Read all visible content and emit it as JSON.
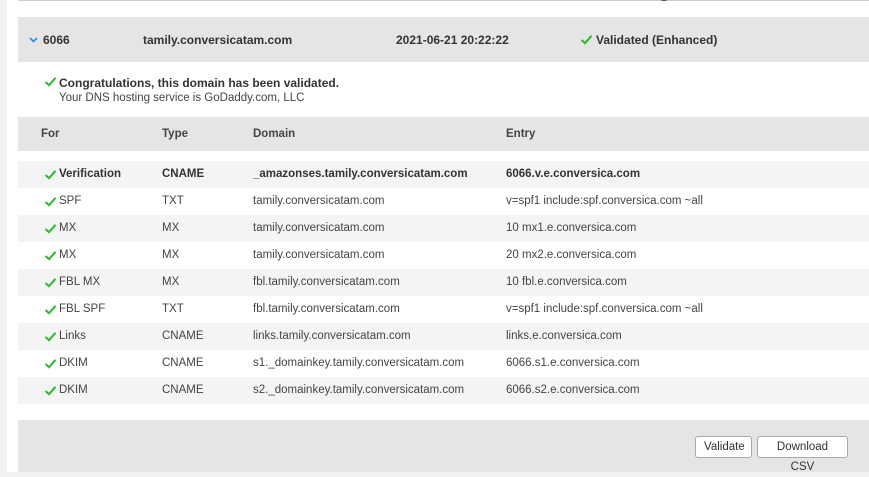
{
  "summary": {
    "id": "6066",
    "domain": "tamily.conversicatam.com",
    "timestamp": "2021-06-21 20:22:22",
    "status": "Validated (Enhanced)"
  },
  "message": {
    "title": "Congratulations, this domain has been validated.",
    "hosting": "Your DNS hosting service is GoDaddy.com, LLC"
  },
  "table": {
    "headers": {
      "for": "For",
      "type": "Type",
      "domain": "Domain",
      "entry": "Entry"
    },
    "rows": [
      {
        "for": "Verification",
        "type": "CNAME",
        "domain": "_amazonses.tamily.conversicatam.com",
        "entry": "6066.v.e.conversica.com"
      },
      {
        "for": "SPF",
        "type": "TXT",
        "domain": "tamily.conversicatam.com",
        "entry": "v=spf1 include:spf.conversica.com ~all"
      },
      {
        "for": "MX",
        "type": "MX",
        "domain": "tamily.conversicatam.com",
        "entry": "10 mx1.e.conversica.com"
      },
      {
        "for": "MX",
        "type": "MX",
        "domain": "tamily.conversicatam.com",
        "entry": "20 mx2.e.conversica.com"
      },
      {
        "for": "FBL MX",
        "type": "MX",
        "domain": "fbl.tamily.conversicatam.com",
        "entry": "10 fbl.e.conversica.com"
      },
      {
        "for": "FBL SPF",
        "type": "TXT",
        "domain": "fbl.tamily.conversicatam.com",
        "entry": "v=spf1 include:spf.conversica.com ~all"
      },
      {
        "for": "Links",
        "type": "CNAME",
        "domain": "links.tamily.conversicatam.com",
        "entry": "links.e.conversica.com"
      },
      {
        "for": "DKIM",
        "type": "CNAME",
        "domain": "s1._domainkey.tamily.conversicatam.com",
        "entry": "6066.s1.e.conversica.com"
      },
      {
        "for": "DKIM",
        "type": "CNAME",
        "domain": "s2._domainkey.tamily.conversicatam.com",
        "entry": "6066.s2.e.conversica.com"
      }
    ]
  },
  "buttons": {
    "validate": "Validate",
    "download_csv": "Download CSV"
  },
  "colors": {
    "check": "#2eb82e",
    "chevron": "#3a8fd6",
    "panel_gray": "#e5e5e5",
    "stripe": "#f4f4f4"
  },
  "icons": {
    "status": "check-icon",
    "expand": "chevron-down-icon"
  }
}
